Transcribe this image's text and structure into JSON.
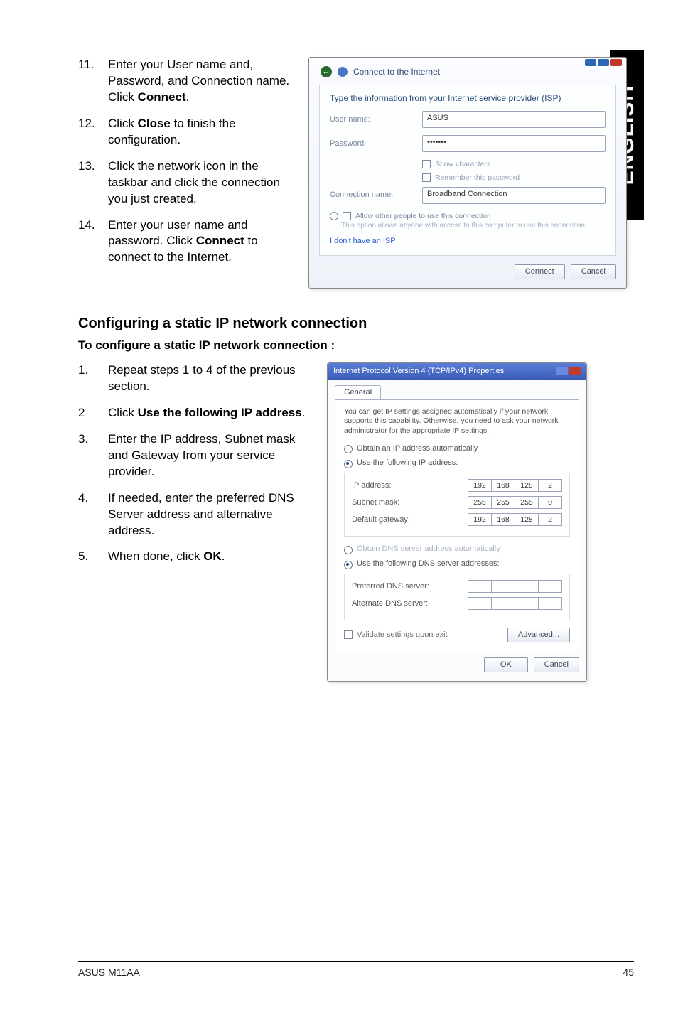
{
  "side_tab": "ENGLISH",
  "steps_top": [
    {
      "n": "11.",
      "html": "Enter your User name and, Password, and Connection name. Click <b>Connect</b>."
    },
    {
      "n": "12.",
      "html": "Click <b>Close</b> to finish the configuration."
    },
    {
      "n": "13.",
      "html": "Click the network icon in the taskbar and click the connection you just created."
    },
    {
      "n": "14.",
      "html": "Enter your user name and password. Click <b>Connect</b> to connect to the Internet."
    }
  ],
  "section_heading": "Configuring a static IP network connection",
  "section_sub": "To configure a static IP network connection :",
  "steps_static": [
    {
      "n": "1.",
      "html": "Repeat steps 1 to 4 of the previous section."
    },
    {
      "n": "2",
      "html": "Click <b>Use the following IP address</b>."
    },
    {
      "n": "3.",
      "html": "Enter the IP address, Subnet mask and Gateway from your service provider."
    },
    {
      "n": "4.",
      "html": "If needed, enter the preferred DNS Server address and alternative address."
    },
    {
      "n": "5.",
      "html": "When done, click <b>OK</b>."
    }
  ],
  "dlg1": {
    "wizard_title": "Connect to the Internet",
    "instruction": "Type the information from your Internet service provider (ISP)",
    "fields": {
      "user_label": "User name:",
      "user_value": "ASUS",
      "pass_label": "Password:",
      "pass_value": "•••••••",
      "conn_label": "Connection name:",
      "conn_value": "Broadband Connection"
    },
    "checks": {
      "show_chars": "Show characters",
      "remember": "Remember this password"
    },
    "allow": "Allow other people to use this connection",
    "allow_desc": "This option allows anyone with access to this computer to use this connection.",
    "link": "I don't have an ISP",
    "btn_connect": "Connect",
    "btn_cancel": "Cancel"
  },
  "dlg2": {
    "title": "Internet Protocol Version 4 (TCP/IPv4) Properties",
    "tab": "General",
    "desc": "You can get IP settings assigned automatically if your network supports this capability. Otherwise, you need to ask your network administrator for the appropriate IP settings.",
    "r_auto_ip": "Obtain an IP address automatically",
    "r_static_ip": "Use the following IP address:",
    "ip_label": "IP address:",
    "ip_segs": [
      "192",
      "168",
      "128",
      "2"
    ],
    "mask_label": "Subnet mask:",
    "mask_segs": [
      "255",
      "255",
      "255",
      "0"
    ],
    "gw_label": "Default gateway:",
    "gw_segs": [
      "192",
      "168",
      "128",
      "2"
    ],
    "r_auto_dns": "Obtain DNS server address automatically",
    "r_static_dns": "Use the following DNS server addresses:",
    "pref_label": "Preferred DNS server:",
    "pref_segs": [
      "",
      "",
      "",
      ""
    ],
    "alt_label": "Alternate DNS server:",
    "alt_segs": [
      "",
      "",
      "",
      ""
    ],
    "validate": "Validate settings upon exit",
    "btn_adv": "Advanced...",
    "btn_ok": "OK",
    "btn_cancel": "Cancel"
  },
  "footer": {
    "left": "ASUS M11AA",
    "right": "45"
  }
}
